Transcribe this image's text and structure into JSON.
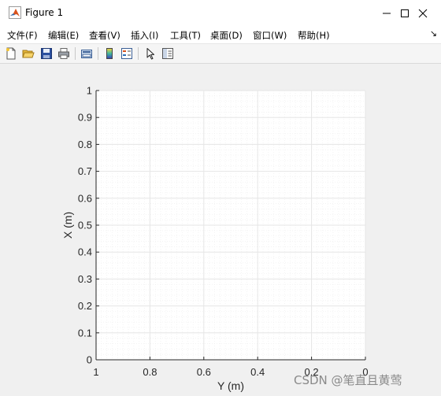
{
  "window": {
    "title": "Figure 1"
  },
  "menubar": {
    "items": [
      "文件(F)",
      "编辑(E)",
      "查看(V)",
      "插入(I)",
      "工具(T)",
      "桌面(D)",
      "窗口(W)",
      "帮助(H)"
    ]
  },
  "toolbar": {
    "buttons": [
      "new-figure-icon",
      "open-file-icon",
      "save-icon",
      "print-icon",
      "link-plot-icon",
      "colorbar-icon",
      "legend-icon",
      "edit-plot-arrow-icon",
      "property-inspector-icon"
    ]
  },
  "chart_data": {
    "type": "line",
    "series": [],
    "xlabel": "Y (m)",
    "ylabel": "X (m)",
    "xlim": [
      0,
      1
    ],
    "ylim": [
      0,
      1
    ],
    "x_direction": "reversed",
    "xticks": [
      "1",
      "0.8",
      "0.6",
      "0.4",
      "0.2",
      "0"
    ],
    "yticks": [
      "0",
      "0.1",
      "0.2",
      "0.3",
      "0.4",
      "0.5",
      "0.6",
      "0.7",
      "0.8",
      "0.9",
      "1"
    ],
    "grid": true,
    "minor_grid": true
  },
  "watermark": {
    "text": "CSDN @笔直且黄莺"
  },
  "colors": {
    "plot_background": "#ffffff",
    "grid": "#e6e6e6",
    "axis": "#262626",
    "window_background": "#f0f0f0"
  }
}
